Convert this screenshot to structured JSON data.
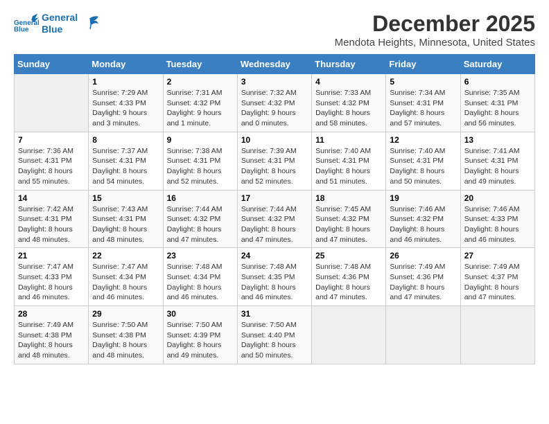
{
  "logo": {
    "line1": "General",
    "line2": "Blue"
  },
  "title": "December 2025",
  "subtitle": "Mendota Heights, Minnesota, United States",
  "days_of_week": [
    "Sunday",
    "Monday",
    "Tuesday",
    "Wednesday",
    "Thursday",
    "Friday",
    "Saturday"
  ],
  "weeks": [
    [
      {
        "day": "",
        "info": ""
      },
      {
        "day": "1",
        "info": "Sunrise: 7:29 AM\nSunset: 4:33 PM\nDaylight: 9 hours\nand 3 minutes."
      },
      {
        "day": "2",
        "info": "Sunrise: 7:31 AM\nSunset: 4:32 PM\nDaylight: 9 hours\nand 1 minute."
      },
      {
        "day": "3",
        "info": "Sunrise: 7:32 AM\nSunset: 4:32 PM\nDaylight: 9 hours\nand 0 minutes."
      },
      {
        "day": "4",
        "info": "Sunrise: 7:33 AM\nSunset: 4:32 PM\nDaylight: 8 hours\nand 58 minutes."
      },
      {
        "day": "5",
        "info": "Sunrise: 7:34 AM\nSunset: 4:31 PM\nDaylight: 8 hours\nand 57 minutes."
      },
      {
        "day": "6",
        "info": "Sunrise: 7:35 AM\nSunset: 4:31 PM\nDaylight: 8 hours\nand 56 minutes."
      }
    ],
    [
      {
        "day": "7",
        "info": "Sunrise: 7:36 AM\nSunset: 4:31 PM\nDaylight: 8 hours\nand 55 minutes."
      },
      {
        "day": "8",
        "info": "Sunrise: 7:37 AM\nSunset: 4:31 PM\nDaylight: 8 hours\nand 54 minutes."
      },
      {
        "day": "9",
        "info": "Sunrise: 7:38 AM\nSunset: 4:31 PM\nDaylight: 8 hours\nand 52 minutes."
      },
      {
        "day": "10",
        "info": "Sunrise: 7:39 AM\nSunset: 4:31 PM\nDaylight: 8 hours\nand 52 minutes."
      },
      {
        "day": "11",
        "info": "Sunrise: 7:40 AM\nSunset: 4:31 PM\nDaylight: 8 hours\nand 51 minutes."
      },
      {
        "day": "12",
        "info": "Sunrise: 7:40 AM\nSunset: 4:31 PM\nDaylight: 8 hours\nand 50 minutes."
      },
      {
        "day": "13",
        "info": "Sunrise: 7:41 AM\nSunset: 4:31 PM\nDaylight: 8 hours\nand 49 minutes."
      }
    ],
    [
      {
        "day": "14",
        "info": "Sunrise: 7:42 AM\nSunset: 4:31 PM\nDaylight: 8 hours\nand 48 minutes."
      },
      {
        "day": "15",
        "info": "Sunrise: 7:43 AM\nSunset: 4:31 PM\nDaylight: 8 hours\nand 48 minutes."
      },
      {
        "day": "16",
        "info": "Sunrise: 7:44 AM\nSunset: 4:32 PM\nDaylight: 8 hours\nand 47 minutes."
      },
      {
        "day": "17",
        "info": "Sunrise: 7:44 AM\nSunset: 4:32 PM\nDaylight: 8 hours\nand 47 minutes."
      },
      {
        "day": "18",
        "info": "Sunrise: 7:45 AM\nSunset: 4:32 PM\nDaylight: 8 hours\nand 47 minutes."
      },
      {
        "day": "19",
        "info": "Sunrise: 7:46 AM\nSunset: 4:32 PM\nDaylight: 8 hours\nand 46 minutes."
      },
      {
        "day": "20",
        "info": "Sunrise: 7:46 AM\nSunset: 4:33 PM\nDaylight: 8 hours\nand 46 minutes."
      }
    ],
    [
      {
        "day": "21",
        "info": "Sunrise: 7:47 AM\nSunset: 4:33 PM\nDaylight: 8 hours\nand 46 minutes."
      },
      {
        "day": "22",
        "info": "Sunrise: 7:47 AM\nSunset: 4:34 PM\nDaylight: 8 hours\nand 46 minutes."
      },
      {
        "day": "23",
        "info": "Sunrise: 7:48 AM\nSunset: 4:34 PM\nDaylight: 8 hours\nand 46 minutes."
      },
      {
        "day": "24",
        "info": "Sunrise: 7:48 AM\nSunset: 4:35 PM\nDaylight: 8 hours\nand 46 minutes."
      },
      {
        "day": "25",
        "info": "Sunrise: 7:48 AM\nSunset: 4:36 PM\nDaylight: 8 hours\nand 47 minutes."
      },
      {
        "day": "26",
        "info": "Sunrise: 7:49 AM\nSunset: 4:36 PM\nDaylight: 8 hours\nand 47 minutes."
      },
      {
        "day": "27",
        "info": "Sunrise: 7:49 AM\nSunset: 4:37 PM\nDaylight: 8 hours\nand 47 minutes."
      }
    ],
    [
      {
        "day": "28",
        "info": "Sunrise: 7:49 AM\nSunset: 4:38 PM\nDaylight: 8 hours\nand 48 minutes."
      },
      {
        "day": "29",
        "info": "Sunrise: 7:50 AM\nSunset: 4:38 PM\nDaylight: 8 hours\nand 48 minutes."
      },
      {
        "day": "30",
        "info": "Sunrise: 7:50 AM\nSunset: 4:39 PM\nDaylight: 8 hours\nand 49 minutes."
      },
      {
        "day": "31",
        "info": "Sunrise: 7:50 AM\nSunset: 4:40 PM\nDaylight: 8 hours\nand 50 minutes."
      },
      {
        "day": "",
        "info": ""
      },
      {
        "day": "",
        "info": ""
      },
      {
        "day": "",
        "info": ""
      }
    ]
  ]
}
